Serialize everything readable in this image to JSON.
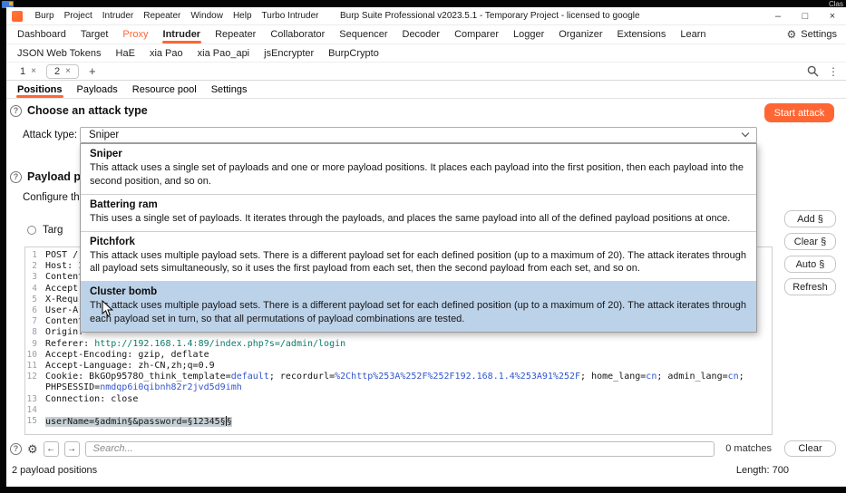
{
  "desktop": {
    "top_right_text": "Clas"
  },
  "titlebar": {
    "title": "Burp Suite Professional v2023.5.1 - Temporary Project - licensed to google",
    "menus": [
      "Burp",
      "Project",
      "Intruder",
      "Repeater",
      "Window",
      "Help",
      "Turbo Intruder"
    ],
    "minimize_glyph": "–",
    "maximize_glyph": "□",
    "close_glyph": "×"
  },
  "main_tabs": {
    "tabs": [
      "Dashboard",
      "Target",
      "Proxy",
      "Intruder",
      "Repeater",
      "Collaborator",
      "Sequencer",
      "Decoder",
      "Comparer",
      "Logger",
      "Organizer",
      "Extensions",
      "Learn"
    ],
    "settings_label": "Settings",
    "settings_gear_glyph": "⚙"
  },
  "extension_tabs": [
    "JSON Web Tokens",
    "HaE",
    "xia Pao",
    "xia Pao_api",
    "jsEncrypter",
    "BurpCrypto"
  ],
  "attack_tabs": {
    "tab1": "1",
    "tab2": "2",
    "close_glyph": "×",
    "new_tab_glyph": "+",
    "more_glyph": "⋮"
  },
  "positions_tabs": [
    "Positions",
    "Payloads",
    "Resource pool",
    "Settings"
  ],
  "attack_type": {
    "help_glyph": "?",
    "heading": "Choose an attack type",
    "label": "Attack type:",
    "value": "Sniper",
    "start_button": "Start attack"
  },
  "dropdown_options": [
    {
      "name": "Sniper",
      "desc": "This attack uses a single set of payloads and one or more payload positions. It places each payload into the first position, then each payload into the second position, and so on."
    },
    {
      "name": "Battering ram",
      "desc": "This uses a single set of payloads. It iterates through the payloads, and places the same payload into all of the defined payload positions at once."
    },
    {
      "name": "Pitchfork",
      "desc": "This attack uses multiple payload sets. There is a different payload set for each defined position (up to a maximum of 20). The attack iterates through all payload sets simultaneously, so it uses the first payload from each set, then the second payload from each set, and so on."
    },
    {
      "name": "Cluster bomb",
      "desc": "This attack uses multiple payload sets. There is a different payload set for each defined position (up to a maximum of 20). The attack iterates through each payload set in turn, so that all permutations of payload combinations are tested."
    }
  ],
  "payload_positions": {
    "help_glyph": "?",
    "heading_visible": "Payload p",
    "configure_visible": "Configure th",
    "target_visible": "Targ",
    "buttons": {
      "add": "Add §",
      "clear": "Clear §",
      "auto": "Auto §",
      "refresh": "Refresh"
    }
  },
  "request_editor": {
    "lines": [
      {
        "n": "1",
        "segs": [
          {
            "t": "POST /"
          }
        ]
      },
      {
        "n": "2",
        "segs": [
          {
            "t": "Host: 1"
          }
        ]
      },
      {
        "n": "3",
        "segs": [
          {
            "t": "Content"
          }
        ]
      },
      {
        "n": "4",
        "segs": [
          {
            "t": "Accept:"
          }
        ]
      },
      {
        "n": "5",
        "segs": [
          {
            "t": "X-Requ"
          }
        ]
      },
      {
        "n": "6",
        "segs": [
          {
            "t": "User-A"
          }
        ]
      },
      {
        "n": "7",
        "segs": [
          {
            "t": "Content"
          }
        ]
      },
      {
        "n": "8",
        "segs": [
          {
            "t": "Origin:"
          }
        ]
      },
      {
        "n": "9",
        "segs": [
          {
            "t": "Referer: "
          },
          {
            "t": "http://192.168.1.4:89/index.php?s=/admin/login"
          }
        ]
      },
      {
        "n": "10",
        "segs": [
          {
            "t": "Accept-Encoding: gzip, deflate"
          }
        ]
      },
      {
        "n": "11",
        "segs": [
          {
            "t": "Accept-Language: zh-CN,zh;q=0.9"
          }
        ]
      },
      {
        "n": "12",
        "segs": [
          {
            "t": "Cookie: BkGOp9578O_think_template="
          },
          {
            "t": "default"
          },
          {
            "t": "; recordurl="
          },
          {
            "t": "%2Chttp%253A%252F%252F192.168.1.4%253A91%252F"
          },
          {
            "t": "; home_lang="
          },
          {
            "t": "cn"
          },
          {
            "t": "; admin_lang="
          },
          {
            "t": "cn"
          },
          {
            "t": "; PHPSESSID="
          },
          {
            "t": "nmdqp6i0qibnh82r2jvd5d9imh"
          }
        ]
      },
      {
        "n": "13",
        "segs": [
          {
            "t": "Connection: close"
          }
        ]
      },
      {
        "n": "14",
        "segs": [
          {
            "t": ""
          }
        ]
      },
      {
        "n": "15",
        "segs": [
          {
            "t": "userName=§admin§&password=§12345§"
          },
          {
            "t": "§"
          }
        ]
      }
    ]
  },
  "search_bar": {
    "help_glyph": "?",
    "gear_glyph": "⚙",
    "prev_glyph": "←",
    "next_glyph": "→",
    "placeholder": "Search...",
    "matches": "0 matches",
    "clear_button": "Clear"
  },
  "status_bar": {
    "left": "2 payload positions",
    "right": "Length: 700"
  },
  "colors": {
    "accent": "#ff6633",
    "dropdown_highlight": "#bcd2e8",
    "selection": "#c6d0d5"
  }
}
